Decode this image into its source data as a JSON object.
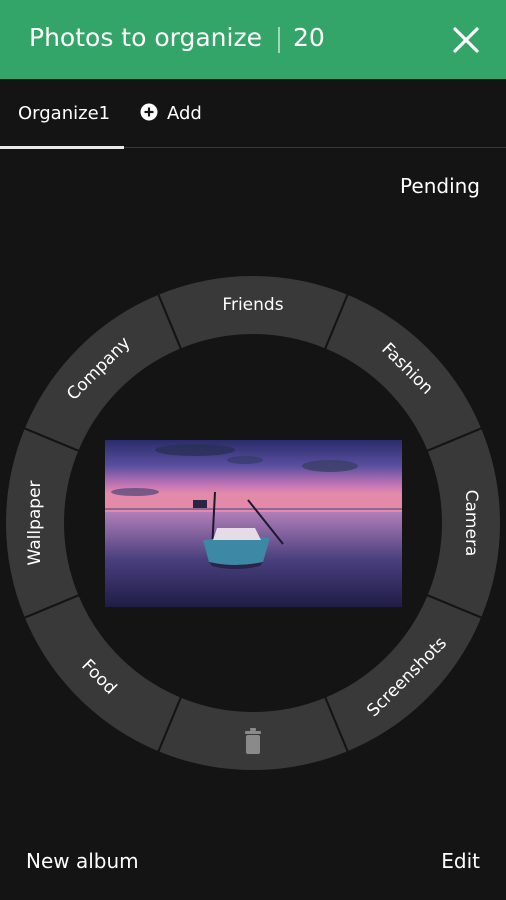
{
  "header": {
    "title": "Photos to organize",
    "count": "20",
    "bg_color": "#34a568",
    "close_icon": "close-icon"
  },
  "tabs": [
    {
      "label": "Organize1",
      "active": true
    },
    {
      "label": "Add",
      "icon": "add-circle-icon",
      "active": false
    }
  ],
  "pending_label": "Pending",
  "wheel": {
    "segments": [
      {
        "label": "Friends"
      },
      {
        "label": "Fashion"
      },
      {
        "label": "Camera"
      },
      {
        "label": "Screenshots"
      },
      {
        "label": "",
        "icon": "trash-icon"
      },
      {
        "label": "Food"
      },
      {
        "label": "Wallpaper"
      },
      {
        "label": "Company"
      }
    ]
  },
  "footer": {
    "new_album_label": "New album",
    "edit_label": "Edit"
  }
}
